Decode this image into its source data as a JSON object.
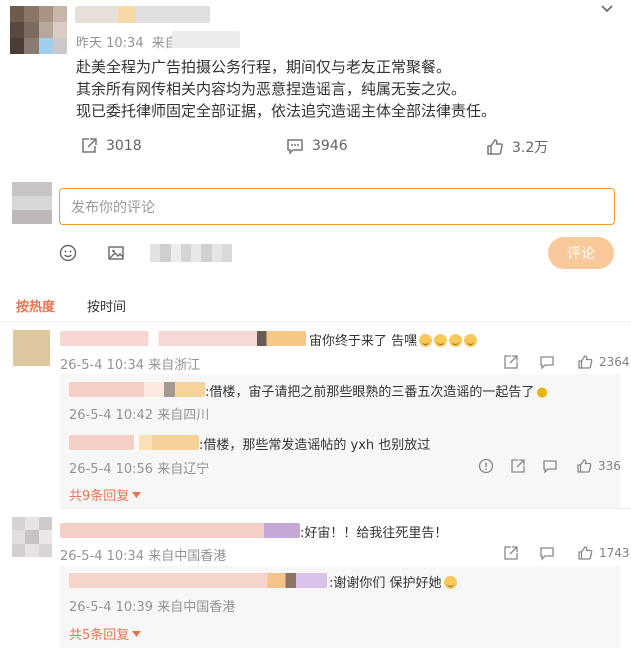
{
  "post": {
    "timestamp": "昨天 10:34",
    "source_prefix": "来自",
    "lines": [
      "赴美全程为广告拍摄公务行程，期间仅与老友正常聚餐。",
      "其余所有网传相关内容均为恶意捏造谣言，纯属无妄之灾。",
      "现已委托律师固定全部证据，依法追究造谣主体全部法律责任。"
    ],
    "reposts": "3018",
    "comments": "3946",
    "likes": "3.2万"
  },
  "composer": {
    "placeholder": "发布你的评论",
    "send_label": "评论"
  },
  "sort": {
    "hot": "按热度",
    "time": "按时间"
  },
  "comments": [
    {
      "text": "宙你终于来了 告嘿",
      "meta": "26-5-4 10:34 来自浙江",
      "likes": "2364",
      "replies": [
        {
          "text": ":借楼，宙子请把之前那些眼熟的三番五次造谣的一起告了",
          "meta": "26-5-4 10:42 来自四川",
          "likes": ""
        },
        {
          "text": ":借楼，那些常发造谣帖的 yxh 也别放过",
          "meta": "26-5-4 10:56 来自辽宁",
          "likes": "336"
        }
      ],
      "more": "共9条回复"
    },
    {
      "text": ":好宙！！给我往死里告！",
      "meta": "26-5-4 10:34 来自中国香港",
      "likes": "1743",
      "replies": [
        {
          "text": ":谢谢你们 保护好她",
          "meta": "26-5-4 10:39 来自中国香港",
          "likes": ""
        }
      ],
      "more": "共5条回复"
    }
  ],
  "colors": {
    "accent": "#eb7350",
    "focus_border": "#f09b3a",
    "send_bg": "#f9c99a",
    "meta": "#939393"
  },
  "icons": [
    "chevron-down-icon",
    "repost-icon",
    "comment-icon",
    "like-icon",
    "emoji-icon",
    "image-icon",
    "share-icon",
    "reply-icon",
    "report-icon"
  ]
}
